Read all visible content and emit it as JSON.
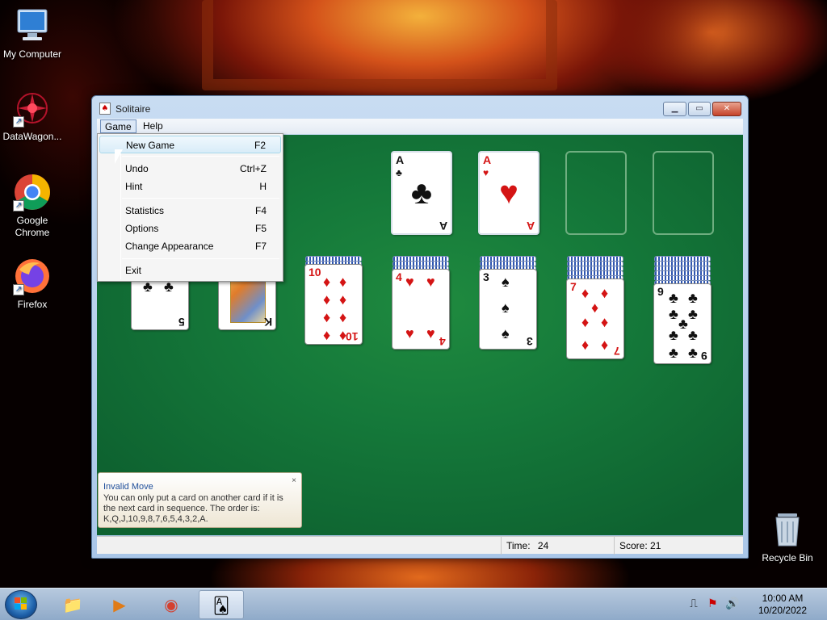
{
  "desktop": {
    "icons": [
      {
        "label": "My Computer",
        "glyph": "🖥"
      },
      {
        "label": "DataWagon...",
        "glyph": "✺"
      },
      {
        "label": "Google Chrome",
        "glyph": "◉"
      },
      {
        "label": "Firefox",
        "glyph": "◍"
      }
    ],
    "recycle_bin": {
      "label": "Recycle Bin",
      "glyph": "🗑"
    }
  },
  "window": {
    "title": "Solitaire",
    "title_icon": "♠",
    "buttons": {
      "minimize": "▁",
      "maximize": "▭",
      "close": "✕"
    },
    "menu": {
      "game": "Game",
      "help": "Help"
    }
  },
  "game_menu": {
    "items": [
      {
        "label": "New Game",
        "shortcut": "F2"
      },
      {
        "label": "Undo",
        "shortcut": "Ctrl+Z"
      },
      {
        "label": "Hint",
        "shortcut": "H"
      },
      {
        "label": "Statistics",
        "shortcut": "F4"
      },
      {
        "label": "Options",
        "shortcut": "F5"
      },
      {
        "label": "Change Appearance",
        "shortcut": "F7"
      },
      {
        "label": "Exit",
        "shortcut": ""
      }
    ]
  },
  "foundations": [
    {
      "rank": "A",
      "suit": "♣",
      "color": "blk"
    },
    {
      "rank": "A",
      "suit": "♥",
      "color": "red"
    }
  ],
  "tableau": [
    {
      "rank": "5",
      "suit": "♣",
      "color": "blk"
    },
    {
      "rank": "K",
      "suit": "♣",
      "color": "blk"
    },
    {
      "rank": "10",
      "suit": "♦",
      "color": "red"
    },
    {
      "rank": "4",
      "suit": "♥",
      "color": "red"
    },
    {
      "rank": "3",
      "suit": "♠",
      "color": "blk"
    },
    {
      "rank": "7",
      "suit": "♦",
      "color": "red"
    },
    {
      "rank": "9",
      "suit": "♣",
      "color": "blk"
    }
  ],
  "notification": {
    "title": "Invalid Move",
    "body": "You can only put a card on another card if it is the next card in sequence. The order is: K,Q,J,10,9,8,7,6,5,4,3,2,A.",
    "close": "×"
  },
  "status": {
    "time_label": "Time:",
    "time_value": "24",
    "score_label": "Score:",
    "score_value": "21"
  },
  "taskbar": {
    "items": [
      {
        "name": "explorer",
        "glyph": "📁"
      },
      {
        "name": "media-player",
        "glyph": "▶"
      },
      {
        "name": "chrome",
        "glyph": "◉"
      },
      {
        "name": "solitaire",
        "glyph": "🂡"
      }
    ],
    "tray_icons": [
      "⎍",
      "⚑",
      "🔊"
    ],
    "time": "10:00 AM",
    "date": "10/20/2022"
  }
}
